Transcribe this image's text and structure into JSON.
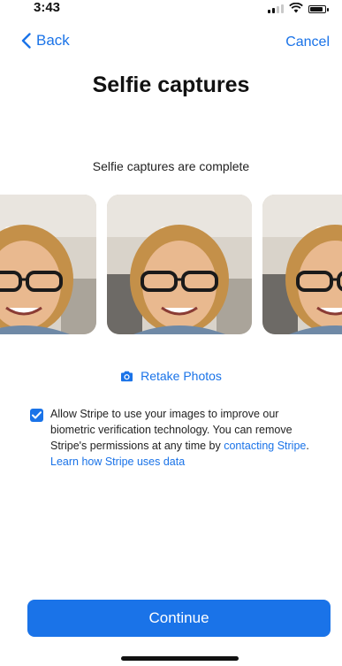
{
  "status_bar": {
    "time": "3:43"
  },
  "nav": {
    "back_label": "Back",
    "cancel_label": "Cancel"
  },
  "page": {
    "title": "Selfie captures",
    "subtitle": "Selfie captures are complete"
  },
  "photos": [
    "selfie-1",
    "selfie-2",
    "selfie-3"
  ],
  "retake": {
    "label": "Retake Photos",
    "icon": "camera-icon"
  },
  "consent": {
    "checked": true,
    "text": "Allow Stripe to use your images to improve our biometric verification technology. You can remove Stripe's permissions at any time by",
    "link_contact": "contacting Stripe",
    "separator": ".",
    "link_learn": "Learn how Stripe uses data"
  },
  "footer": {
    "continue_label": "Continue"
  },
  "colors": {
    "accent": "#1a73e8",
    "text": "#111111"
  }
}
